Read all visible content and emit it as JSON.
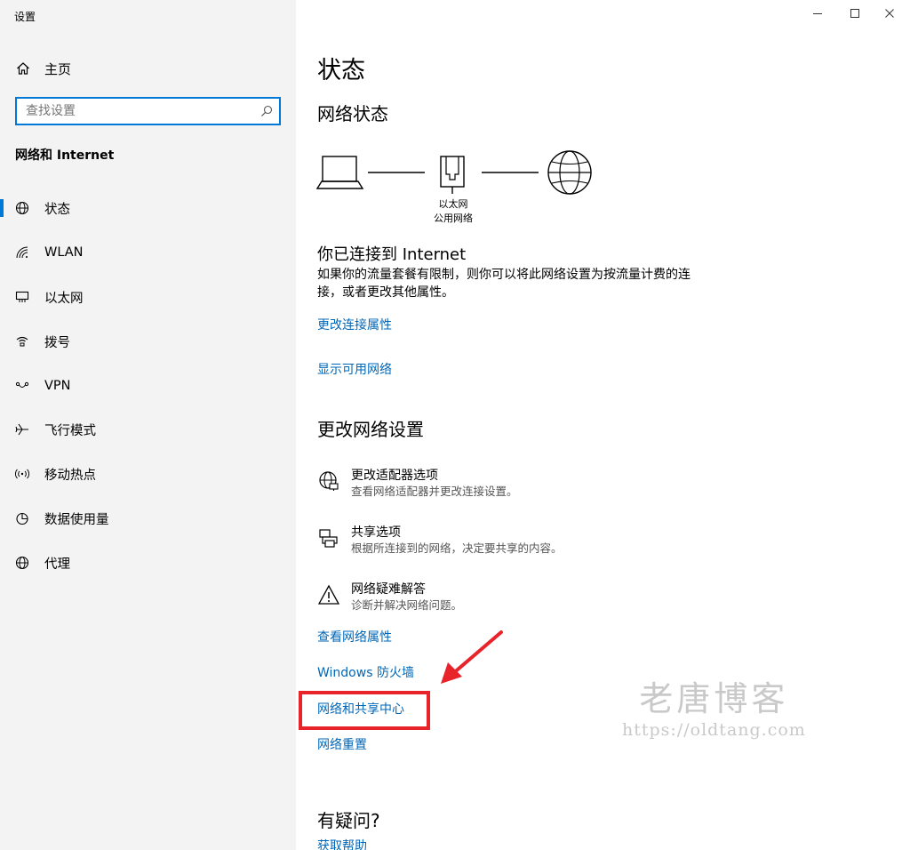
{
  "window": {
    "title": "设置",
    "minimize": "—",
    "maximize": "☐",
    "close": "✕"
  },
  "sidebar": {
    "home_label": "主页",
    "search_placeholder": "查找设置",
    "section_title": "网络和 Internet",
    "items": [
      {
        "label": "状态",
        "icon": "globe-icon",
        "active": true
      },
      {
        "label": "WLAN",
        "icon": "wifi-icon"
      },
      {
        "label": "以太网",
        "icon": "ethernet-icon"
      },
      {
        "label": "拨号",
        "icon": "dialup-icon"
      },
      {
        "label": "VPN",
        "icon": "vpn-icon"
      },
      {
        "label": "飞行模式",
        "icon": "airplane-icon"
      },
      {
        "label": "移动热点",
        "icon": "hotspot-icon"
      },
      {
        "label": "数据使用量",
        "icon": "data-usage-icon"
      },
      {
        "label": "代理",
        "icon": "proxy-icon"
      }
    ]
  },
  "main": {
    "title": "状态",
    "network_status_heading": "网络状态",
    "adapter_name": "以太网",
    "network_profile": "公用网络",
    "connected_title": "你已连接到 Internet",
    "connected_desc": "如果你的流量套餐有限制，则你可以将此网络设置为按流量计费的连接，或者更改其他属性。",
    "links_top": [
      "更改连接属性",
      "显示可用网络"
    ],
    "change_settings_heading": "更改网络设置",
    "options": [
      {
        "title": "更改适配器选项",
        "desc": "查看网络适配器并更改连接设置。",
        "icon": "adapter-globe-icon"
      },
      {
        "title": "共享选项",
        "desc": "根据所连接到的网络，决定要共享的内容。",
        "icon": "sharing-icon"
      },
      {
        "title": "网络疑难解答",
        "desc": "诊断并解决网络问题。",
        "icon": "warning-icon"
      }
    ],
    "links_bottom": [
      "查看网络属性",
      "Windows 防火墙",
      "网络和共享中心",
      "网络重置"
    ],
    "questions_heading": "有疑问?",
    "help_link": "获取帮助"
  },
  "watermark": {
    "title": "老唐博客",
    "url": "https://oldtang.com"
  },
  "colors": {
    "accent": "#0078d7",
    "link": "#0067b8",
    "highlight": "#e8232a",
    "sidebar_bg": "#f3f3f3"
  }
}
